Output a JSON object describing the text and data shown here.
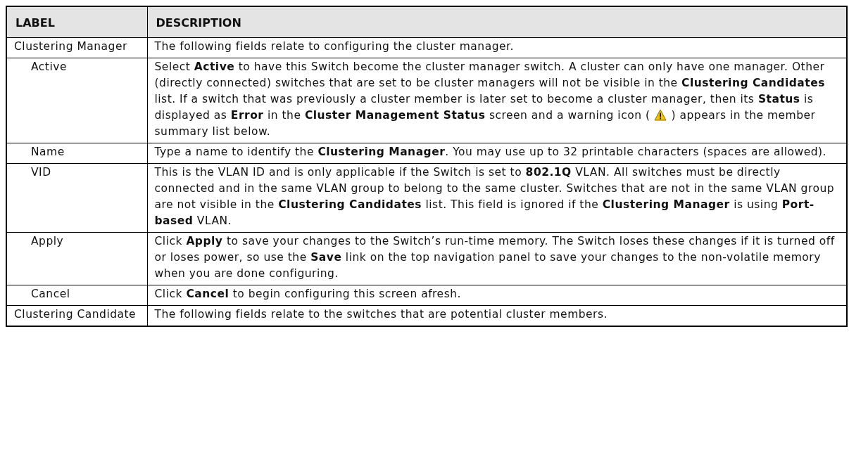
{
  "table": {
    "columns": [
      "LABEL",
      "DESCRIPTION"
    ],
    "rows": [
      {
        "label": "Clustering Manager",
        "description": [
          {
            "kind": "text",
            "text": "The following fields relate to configuring the cluster manager."
          }
        ],
        "children": [
          {
            "label": "Active",
            "description": [
              {
                "kind": "text",
                "text": "Select **Active** to have this Switch become the cluster manager switch. A cluster can only have one manager. Other (directly connected) switches that are set to be cluster managers will not be visible in the **Clustering Candidates** list. If a switch that was previously a cluster member is later set to become a cluster manager, then its **Status** is displayed as **Error** in the **Cluster Management Status** screen and a warning icon ("
              },
              {
                "kind": "warning-icon"
              },
              {
                "kind": "text",
                "text": ") appears in the member summary list below."
              }
            ]
          },
          {
            "label": "Name",
            "description": [
              {
                "kind": "text",
                "text": "Type a name to identify the **Clustering Manager**. You may use up to 32 printable characters (spaces are allowed)."
              }
            ]
          },
          {
            "label": "VID",
            "description": [
              {
                "kind": "text",
                "text": "This is the VLAN ID and is only applicable if the Switch is set to **802.1Q** VLAN. All switches must be directly connected and in the same VLAN group to belong to the same cluster. Switches that are not in the same VLAN group are not visible in the **Clustering Candidates** list. This field is ignored if the **Clustering Manager** is using **Port-based** VLAN."
              }
            ]
          },
          {
            "label": "Apply",
            "description": [
              {
                "kind": "text",
                "text": "Click **Apply** to save your changes to the Switch’s run-time memory. The Switch loses these changes if it is turned off or loses power, so use the **Save** link on the top navigation panel to save your changes to the non-volatile memory when you are done configuring."
              }
            ]
          },
          {
            "label": "Cancel",
            "description": [
              {
                "kind": "text",
                "text": "Click **Cancel** to begin configuring this screen afresh."
              }
            ]
          }
        ]
      },
      {
        "label": "Clustering Candidate",
        "description": [
          {
            "kind": "text",
            "text": "The following fields relate to the switches that are potential cluster members."
          }
        ],
        "children": []
      }
    ]
  }
}
